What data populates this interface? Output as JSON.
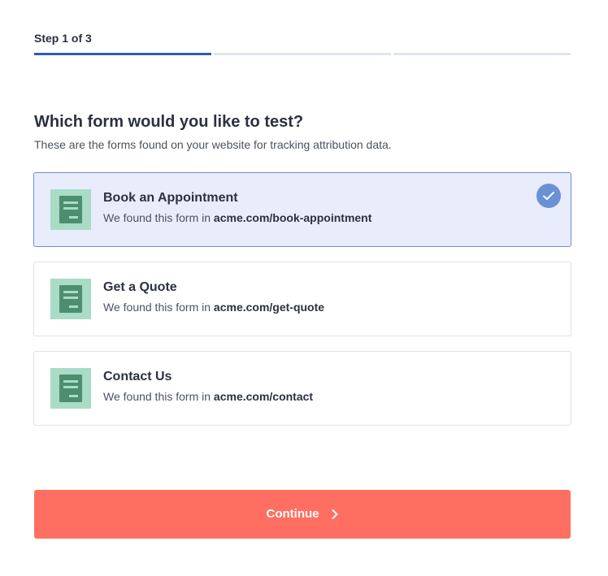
{
  "stepper": {
    "label": "Step 1 of 3",
    "current_step": 1,
    "total_steps": 3,
    "colors": {
      "active": "#2a5fb0",
      "inactive": "#dfe5ec"
    }
  },
  "question": {
    "title": "Which form would you like to test?",
    "subtitle": "These are the forms found on your website for tracking attribution data."
  },
  "forms": [
    {
      "title": "Book an Appointment",
      "desc_prefix": "We found this form in ",
      "url": "acme.com/book-appointment",
      "selected": true,
      "icon": "form-document-icon"
    },
    {
      "title": "Get a Quote",
      "desc_prefix": "We found this form in ",
      "url": "acme.com/get-quote",
      "selected": false,
      "icon": "form-document-icon"
    },
    {
      "title": "Contact Us",
      "desc_prefix": "We found this form in ",
      "url": "acme.com/contact",
      "selected": false,
      "icon": "form-document-icon"
    }
  ],
  "selected_indicator_icon": "checkmark-icon",
  "continue_button": {
    "label": "Continue",
    "icon": "chevron-right-icon",
    "color": "#ff6f61"
  },
  "colors": {
    "selected_border": "#6a90d6",
    "selected_background": "#e9ecfb",
    "form_icon_background": "#a8dcc6",
    "form_icon_foreground": "#4d8e6e"
  }
}
